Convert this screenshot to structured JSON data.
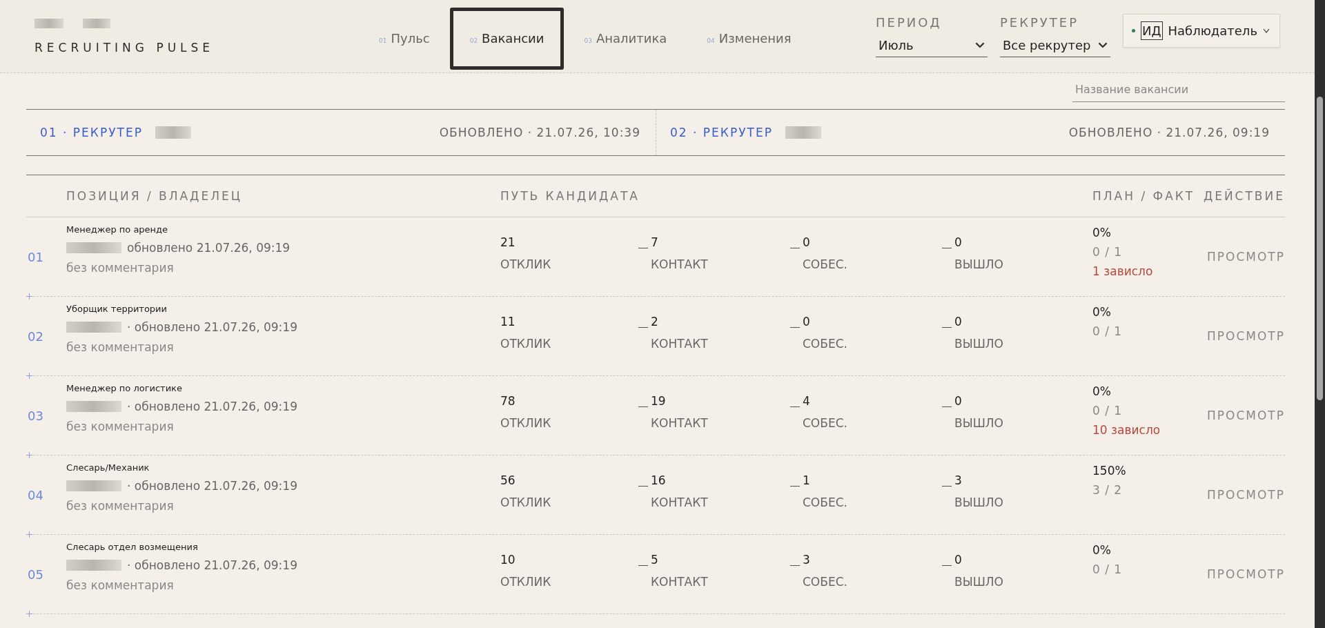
{
  "brand": {
    "title": "RECRUITING PULSE"
  },
  "tabs": [
    {
      "index": "01",
      "label": "Пульс",
      "selected": false
    },
    {
      "index": "02",
      "label": "Вакансии",
      "selected": true
    },
    {
      "index": "03",
      "label": "Аналитика",
      "selected": false
    },
    {
      "index": "04",
      "label": "Изменения",
      "selected": false
    }
  ],
  "filters": [
    {
      "label": "ПЕРИОД",
      "value": "Июль"
    },
    {
      "label": "РЕКРУТЕР",
      "value": "Все рекрутер"
    }
  ],
  "user": {
    "initials": "ИД",
    "role": "Наблюдатель",
    "online": true
  },
  "search": {
    "placeholder": "Название вакансии"
  },
  "recruiters": [
    {
      "label": "01 · РЕКРУТЕР",
      "updated": "ОБНОВЛЕНО · 21.07.26, 10:39"
    },
    {
      "label": "02 · РЕКРУТЕР",
      "updated": "ОБНОВЛЕНО · 21.07.26, 09:19"
    }
  ],
  "table": {
    "columns": [
      "ПОЗИЦИЯ / ВЛАДЕЛЕЦ",
      "ПУТЬ КАНДИДАТА",
      "ПЛАН / ФАКТ",
      "ДЕЙСТВИЕ"
    ],
    "rows": [
      {
        "number": "01",
        "title": "Менеджер по аренде",
        "owner_note": "обновлено 21.07.26, 09:19",
        "comment": "без комментария",
        "stages": [
          {
            "value": "21",
            "label": "ОТКЛИК"
          },
          {
            "value": "7",
            "label": "КОНТАКТ"
          },
          {
            "value": "0",
            "label": "СОБЕС."
          },
          {
            "value": "0",
            "label": "ВЫШЛО"
          }
        ],
        "percent": "0%",
        "plan_fact": "0 / 1",
        "stuck": "1 зависло",
        "action": "ПРОСМОТР"
      },
      {
        "number": "02",
        "title": "Уборщик территории",
        "owner_note": "· обновлено 21.07.26, 09:19",
        "comment": "без комментария",
        "stages": [
          {
            "value": "11",
            "label": "ОТКЛИК"
          },
          {
            "value": "2",
            "label": "КОНТАКТ"
          },
          {
            "value": "0",
            "label": "СОБЕС."
          },
          {
            "value": "0",
            "label": "ВЫШЛО"
          }
        ],
        "percent": "0%",
        "plan_fact": "0 / 1",
        "action": "ПРОСМОТР"
      },
      {
        "number": "03",
        "title": "Менеджер по логистике",
        "owner_note": "· обновлено 21.07.26, 09:19",
        "comment": "без комментария",
        "stages": [
          {
            "value": "78",
            "label": "ОТКЛИК"
          },
          {
            "value": "19",
            "label": "КОНТАКТ"
          },
          {
            "value": "4",
            "label": "СОБЕС."
          },
          {
            "value": "0",
            "label": "ВЫШЛО"
          }
        ],
        "percent": "0%",
        "plan_fact": "0 / 1",
        "stuck": "10 зависло",
        "action": "ПРОСМОТР"
      },
      {
        "number": "04",
        "title": "Слесарь/Механик",
        "owner_note": "· обновлено 21.07.26, 09:19",
        "comment": "без комментария",
        "stages": [
          {
            "value": "56",
            "label": "ОТКЛИК"
          },
          {
            "value": "16",
            "label": "КОНТАКТ"
          },
          {
            "value": "1",
            "label": "СОБЕС."
          },
          {
            "value": "3",
            "label": "ВЫШЛО"
          }
        ],
        "percent": "150%",
        "plan_fact": "3 / 2",
        "action": "ПРОСМОТР"
      },
      {
        "number": "05",
        "title": "Слесарь отдел возмещения",
        "owner_note": "· обновлено 21.07.26, 09:19",
        "comment": "без комментария",
        "stages": [
          {
            "value": "10",
            "label": "ОТКЛИК"
          },
          {
            "value": "5",
            "label": "КОНТАКТ"
          },
          {
            "value": "3",
            "label": "СОБЕС."
          },
          {
            "value": "0",
            "label": "ВЫШЛО"
          }
        ],
        "percent": "0%",
        "plan_fact": "0 / 1",
        "action": "ПРОСМОТР"
      }
    ]
  }
}
